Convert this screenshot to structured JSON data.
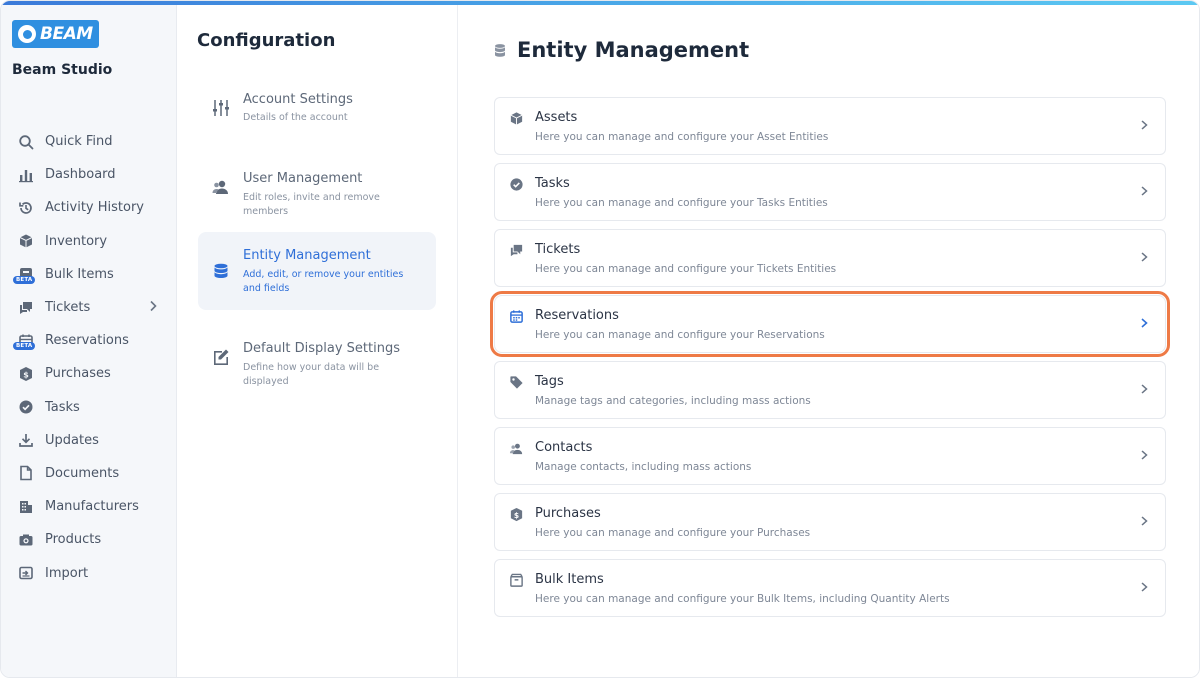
{
  "brand": {
    "logo_text": "BEAM",
    "studio_name": "Beam Studio"
  },
  "sidebar": {
    "items": [
      {
        "label": "Quick Find",
        "icon": "search-icon"
      },
      {
        "label": "Dashboard",
        "icon": "bar-chart-icon"
      },
      {
        "label": "Activity History",
        "icon": "history-icon"
      },
      {
        "label": "Inventory",
        "icon": "cube-icon"
      },
      {
        "label": "Bulk Items",
        "icon": "box-icon",
        "badge": "BETA"
      },
      {
        "label": "Tickets",
        "icon": "chat-icon",
        "has_submenu": true
      },
      {
        "label": "Reservations",
        "icon": "calendar-icon",
        "badge": "BETA"
      },
      {
        "label": "Purchases",
        "icon": "dollar-shield-icon"
      },
      {
        "label": "Tasks",
        "icon": "check-circle-icon"
      },
      {
        "label": "Updates",
        "icon": "download-icon"
      },
      {
        "label": "Documents",
        "icon": "document-icon"
      },
      {
        "label": "Manufacturers",
        "icon": "building-icon"
      },
      {
        "label": "Products",
        "icon": "camera-icon"
      },
      {
        "label": "Import",
        "icon": "import-icon"
      }
    ]
  },
  "config": {
    "title": "Configuration",
    "items": [
      {
        "title": "Account Settings",
        "desc": "Details of the account",
        "icon": "sliders-icon"
      },
      {
        "title": "User Management",
        "desc": "Edit roles, invite and remove members",
        "icon": "users-icon"
      },
      {
        "title": "Entity Management",
        "desc": "Add, edit, or remove your entities and fields",
        "icon": "database-icon",
        "active": true
      },
      {
        "title": "Default Display Settings",
        "desc": "Define how your data will be displayed",
        "icon": "edit-icon"
      }
    ]
  },
  "main": {
    "title": "Entity Management",
    "entities": [
      {
        "title": "Assets",
        "desc": "Here you can manage and configure your Asset Entities",
        "icon": "cube-icon"
      },
      {
        "title": "Tasks",
        "desc": "Here you can manage and configure your Tasks Entities",
        "icon": "check-circle-icon"
      },
      {
        "title": "Tickets",
        "desc": "Here you can manage and configure your Tickets Entities",
        "icon": "chat-icon"
      },
      {
        "title": "Reservations",
        "desc": "Here you can manage and configure your Reservations",
        "icon": "calendar-icon",
        "highlighted": true
      },
      {
        "title": "Tags",
        "desc": "Manage tags and categories, including mass actions",
        "icon": "tag-icon"
      },
      {
        "title": "Contacts",
        "desc": "Manage contacts, including mass actions",
        "icon": "users-icon"
      },
      {
        "title": "Purchases",
        "desc": "Here you can manage and configure your Purchases",
        "icon": "dollar-shield-icon"
      },
      {
        "title": "Bulk Items",
        "desc": "Here you can manage and configure your Bulk Items, including Quantity Alerts",
        "icon": "box-icon"
      }
    ]
  },
  "colors": {
    "accent": "#2f6fd8",
    "highlight_outline": "#ee7a46",
    "logo_bg": "#2f8fe0"
  }
}
